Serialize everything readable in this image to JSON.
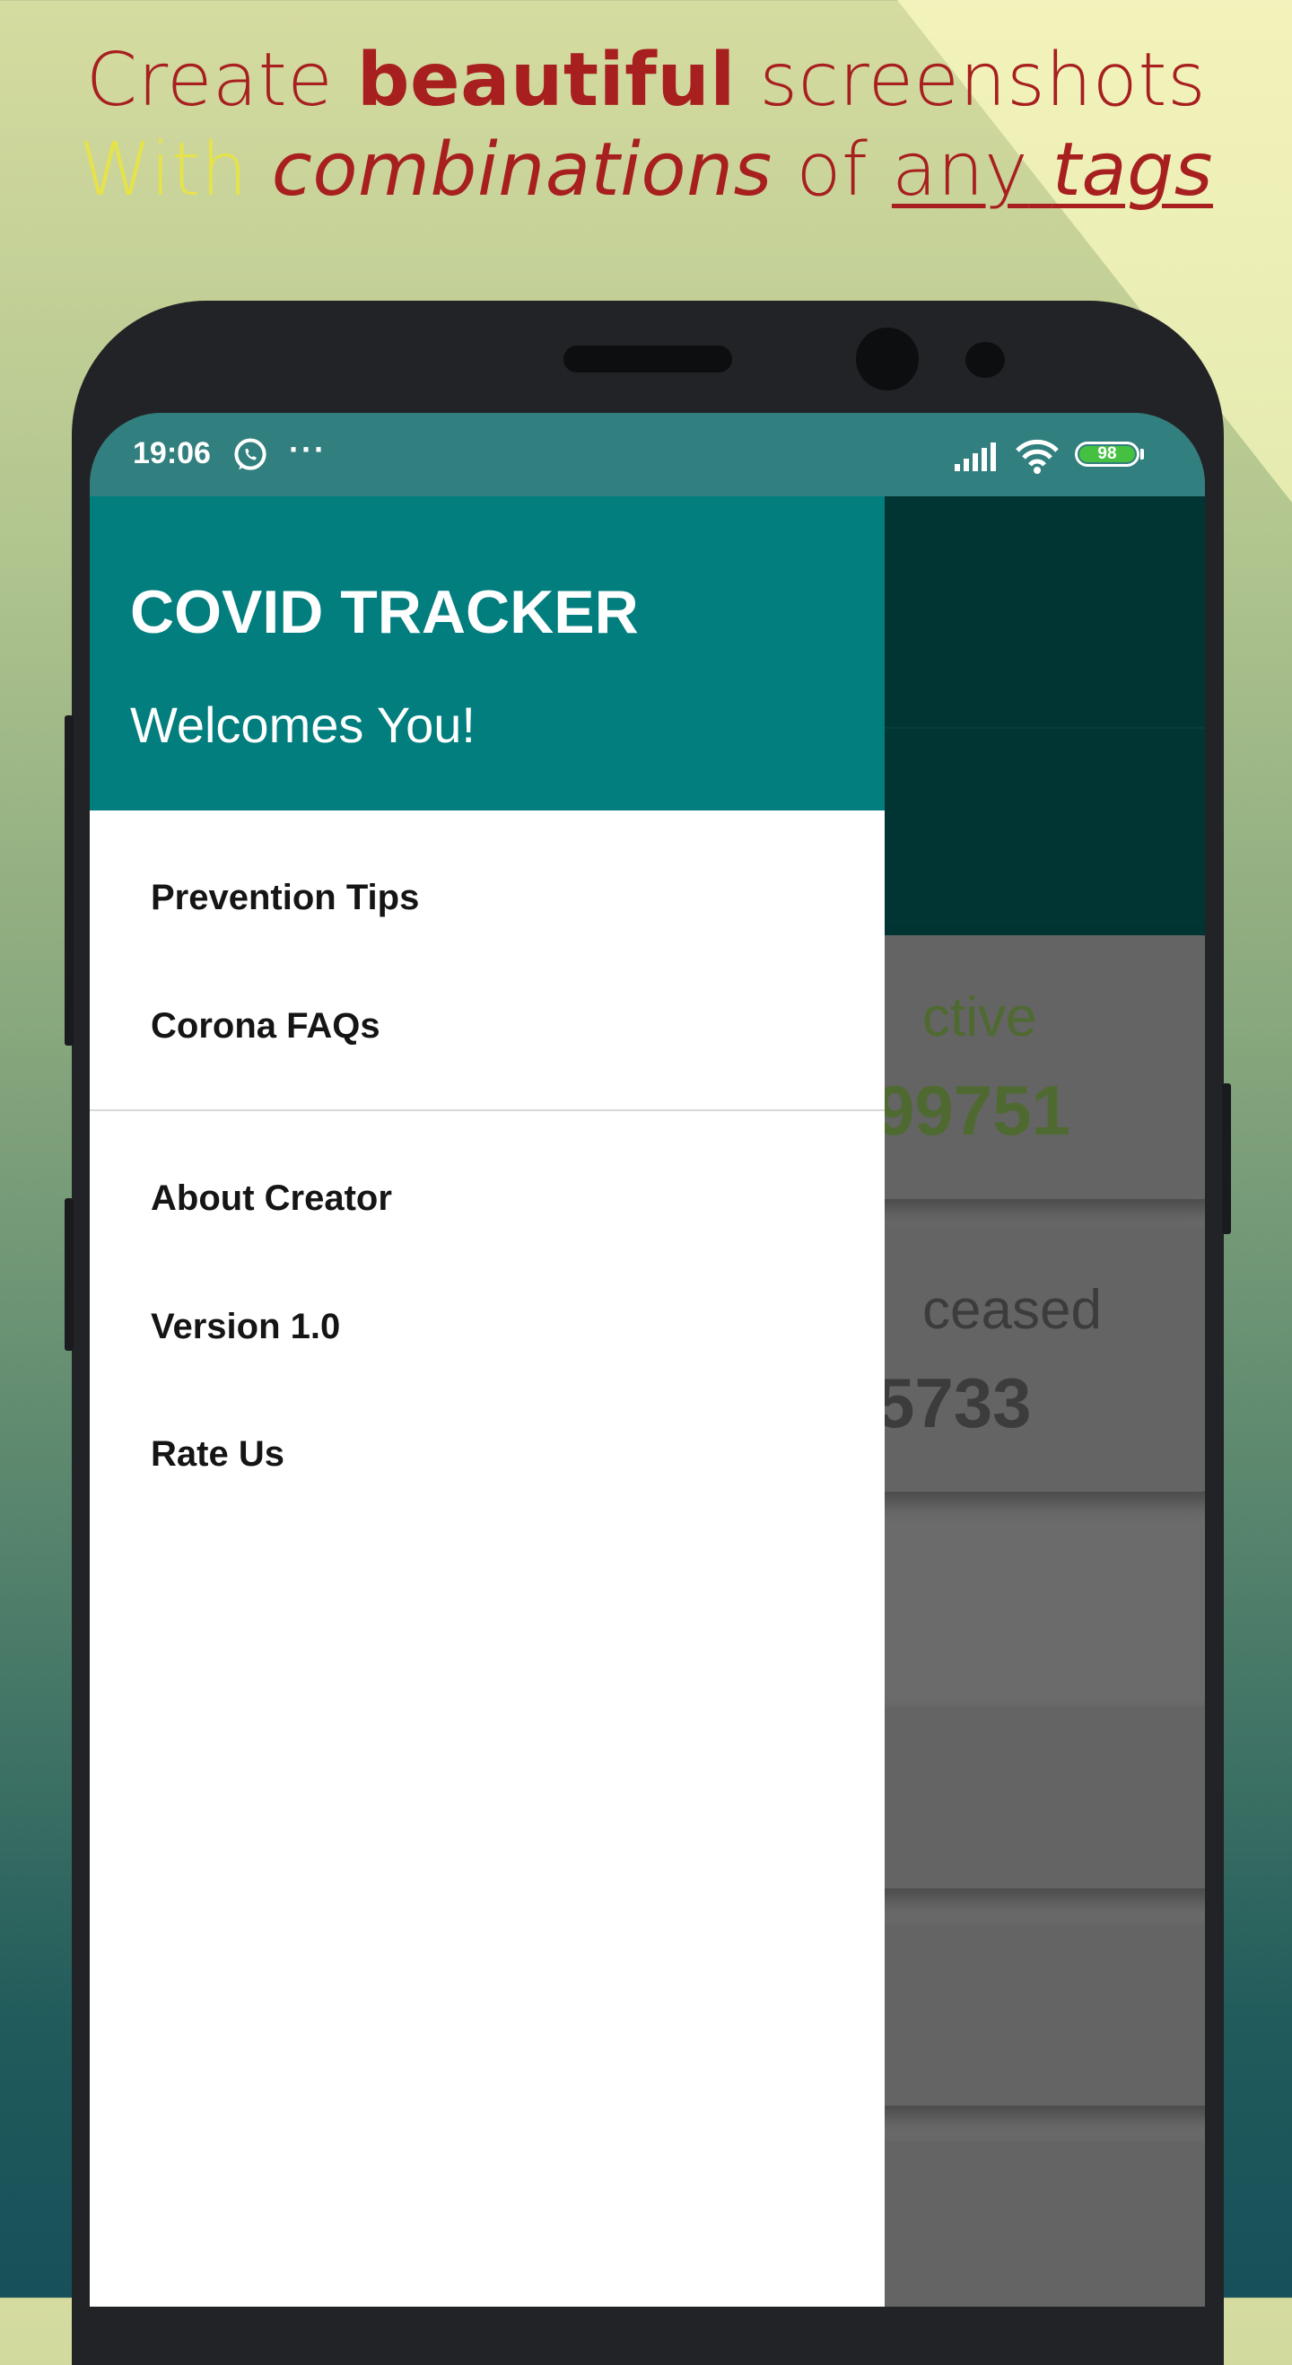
{
  "promo": {
    "l1_a": "Create ",
    "l1_b": "beautiful",
    "l1_c": " screenshots",
    "l2_a": "With ",
    "l2_b": "combinations",
    "l2_c": " of ",
    "l2_d": "any",
    "l2_e": " ",
    "l2_f": "tags"
  },
  "status_bar": {
    "time": "19:06",
    "more": "···",
    "battery": "98",
    "icons": [
      "whatsapp-icon",
      "signal-icon",
      "wifi-icon",
      "battery-icon"
    ]
  },
  "drawer": {
    "title": "COVID TRACKER",
    "subtitle": "Welcomes You!",
    "group1": [
      "Prevention Tips",
      "Corona FAQs"
    ],
    "group2": [
      "About Creator",
      "Version 1.0",
      "Rate Us"
    ]
  },
  "background_cards": {
    "active_label": "ctive",
    "active_value": "99751",
    "deceased_label": "ceased",
    "deceased_value": "5733"
  },
  "colors": {
    "headline": "#a71f1f",
    "headline_yellow": "#e6e34a",
    "status_bar": "#317f7e",
    "drawer_header": "#017e7d",
    "app_bar": "#003534",
    "active_text": "#4e6a30",
    "deceased_text": "#3c3c3c"
  }
}
